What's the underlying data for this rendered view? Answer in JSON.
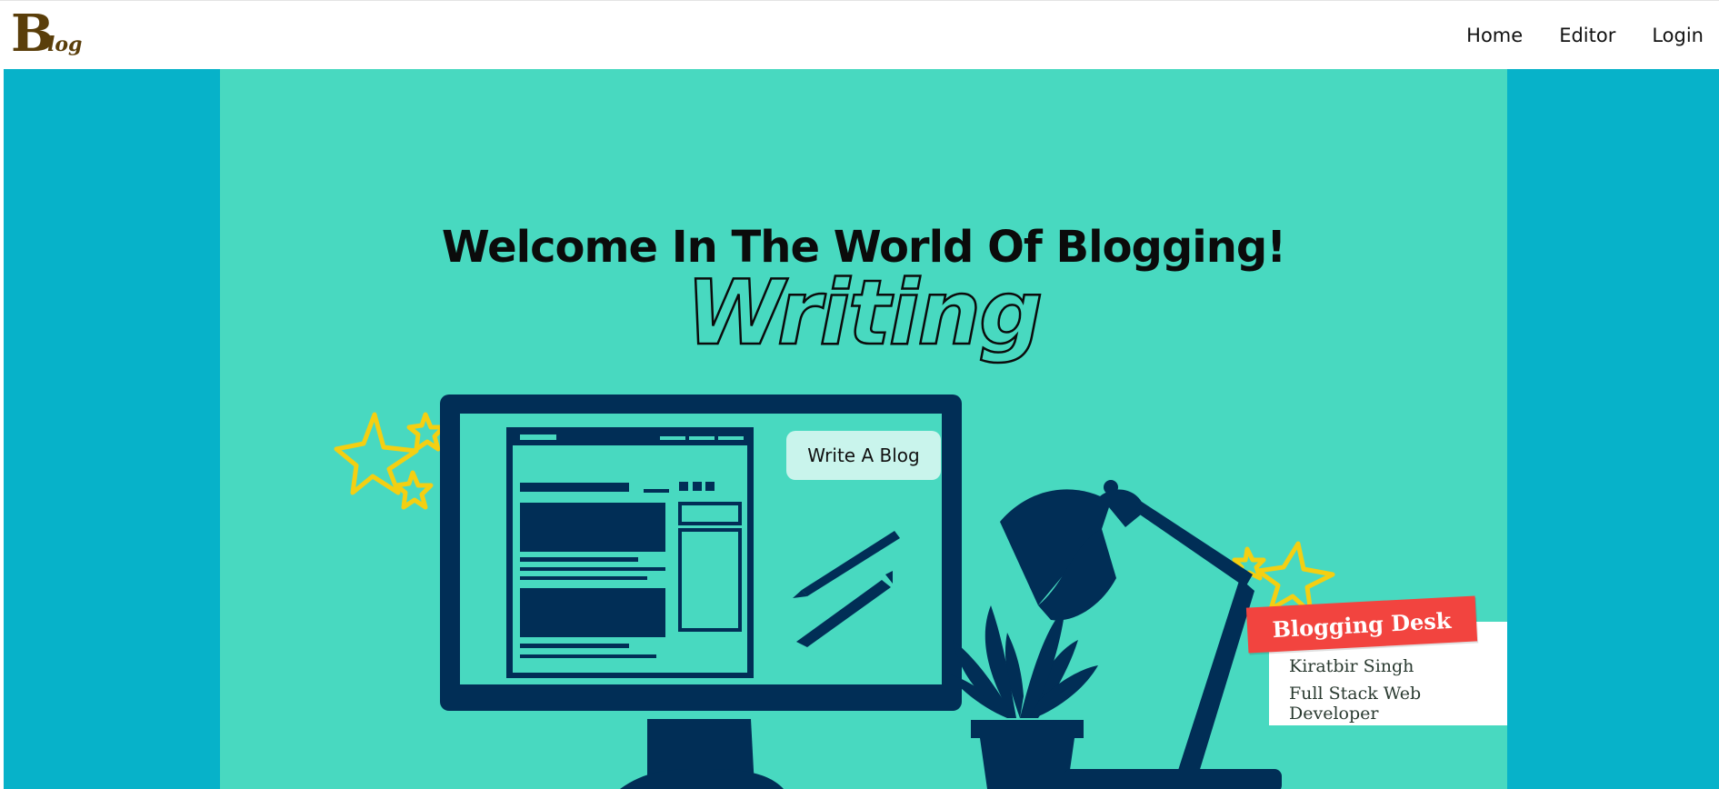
{
  "brand": {
    "logo_big": "B",
    "logo_small": "log"
  },
  "nav": {
    "items": [
      {
        "label": "Home"
      },
      {
        "label": "Editor"
      },
      {
        "label": "Login"
      }
    ]
  },
  "hero": {
    "title": "Welcome In The World Of Blogging!",
    "subtitle": "Writing",
    "cta_label": "Write A Blog"
  },
  "card": {
    "ribbon": "Blogging Desk",
    "name": "Kiratbir Singh",
    "role": "Full Stack Web Developer"
  },
  "colors": {
    "outer_bg": "#07b2c9",
    "hero_bg": "#48d9c0",
    "navy": "#012e56",
    "star": "#f4cf12",
    "ribbon": "#f2443f",
    "logo": "#5a3e0a"
  }
}
